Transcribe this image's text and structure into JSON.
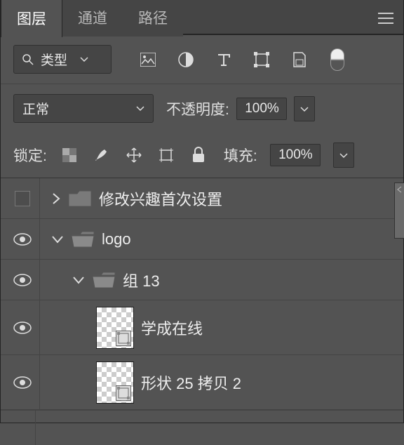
{
  "tabs": {
    "layers": "图层",
    "channels": "通道",
    "paths": "路径"
  },
  "filter": {
    "kind_label": "类型"
  },
  "blend": {
    "mode": "正常",
    "opacity_label": "不透明度:",
    "opacity_value": "100%"
  },
  "lock": {
    "label": "锁定:",
    "fill_label": "填充:",
    "fill_value": "100%"
  },
  "layers": [
    {
      "name": "修改兴趣首次设置"
    },
    {
      "name": "logo"
    },
    {
      "name": "组 13"
    },
    {
      "name": "学成在线"
    },
    {
      "name": "形状 25 拷贝 2"
    }
  ]
}
